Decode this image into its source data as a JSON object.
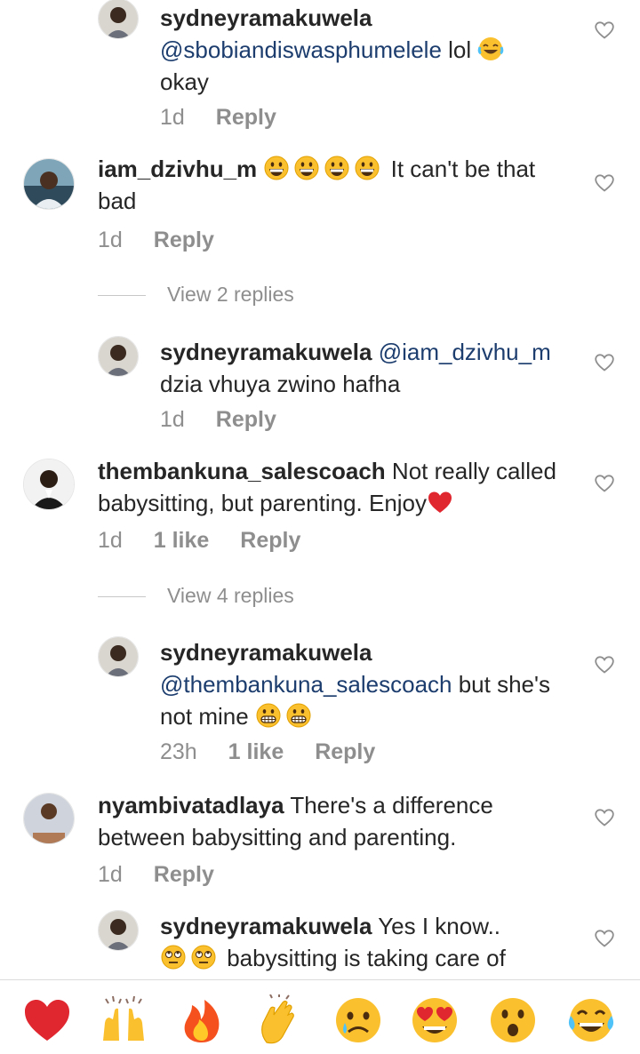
{
  "comments": [
    {
      "id": "c1",
      "user": "sydneyramakuwela",
      "mention": "@sbobiandiswasphumelele",
      "text_after": " lol",
      "line2": "okay",
      "time": "1d",
      "reply": "Reply",
      "emoji": "joy",
      "is_reply": true
    },
    {
      "id": "c2",
      "user": "iam_dzivhu_m",
      "text_after": " It can't be that",
      "line2": "bad",
      "time": "1d",
      "reply": "Reply",
      "emoji_count": 4,
      "emoji": "grin"
    },
    {
      "id": "c3",
      "user": "sydneyramakuwela",
      "mention": "@iam_dzivhu_m",
      "line2": "dzia vhuya zwino hafha",
      "time": "1d",
      "reply": "Reply",
      "is_reply": true
    },
    {
      "id": "c4",
      "user": "thembankuna_salescoach",
      "text_after": " Not really called",
      "line2": "babysitting, but parenting. Enjoy",
      "time": "1d",
      "likes": "1 like",
      "reply": "Reply",
      "emoji": "heart"
    },
    {
      "id": "c5",
      "user": "sydneyramakuwela",
      "mention": "@thembankuna_salescoach",
      "text_after": " but she's",
      "line2": "not mine",
      "time": "23h",
      "likes": "1 like",
      "reply": "Reply",
      "emoji": "grimace",
      "is_reply": true
    },
    {
      "id": "c6",
      "user": "nyambivatadlaya",
      "text_after": " There's a difference",
      "line2": "between babysitting and parenting.",
      "time": "1d",
      "reply": "Reply"
    },
    {
      "id": "c7",
      "user": "sydneyramakuwela",
      "text_after": " Yes I know..",
      "line2": " babysitting is taking care of",
      "is_reply": true,
      "emoji": "eyeroll"
    }
  ],
  "view_replies": [
    "View 2 replies",
    "View 4 replies"
  ],
  "reactions": [
    "heart",
    "raised-hands",
    "fire",
    "clap",
    "sad",
    "heart-eyes",
    "surprised",
    "joy"
  ],
  "colors": {
    "mention": "#1c3d6e",
    "meta": "#8e8e8e",
    "heart_red": "#e0262f",
    "emoji_yellow": "#fbc02d"
  }
}
